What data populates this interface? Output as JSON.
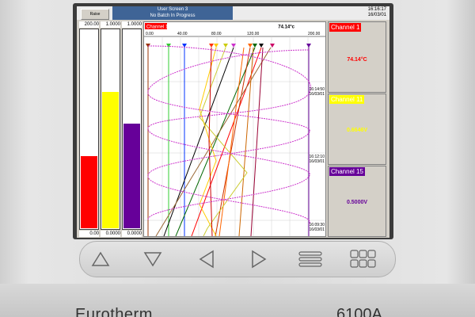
{
  "header": {
    "raise_label": "Raise",
    "screen_title": "User Screen 3",
    "batch_status": "No Batch In Progress",
    "time": "16:16:17",
    "date": "16/03/01"
  },
  "bars": [
    {
      "top": "200.00",
      "bottom": "0.00",
      "color": "#ff0000",
      "fill": 0.37
    },
    {
      "top": "1.0000",
      "bottom": "0.0000",
      "color": "#ffff00",
      "fill": 0.69
    },
    {
      "top": "1.0000",
      "bottom": "0.0000",
      "color": "#660099",
      "fill": 0.53
    }
  ],
  "chart": {
    "channel_label": "Channel 1",
    "value": "74.14°c",
    "scale_ticks": [
      "0.00",
      "40.00",
      "80.00",
      "120.00",
      "200.00"
    ],
    "timestamps": [
      {
        "time": "16:14:50",
        "date": "16/03/01"
      },
      {
        "time": "16:12:10",
        "date": "16/03/01"
      },
      {
        "time": "16:09:30",
        "date": "16/03/01"
      }
    ]
  },
  "panels": [
    {
      "label": "Channel 1",
      "value": "74.14°C",
      "color": "#ff0000",
      "value_color": "#ff0000"
    },
    {
      "label": "Channel 11",
      "value": "0.6646V",
      "color": "#ffff00",
      "value_color": "#ffff00"
    },
    {
      "label": "Channel 15",
      "value": "0.5000V",
      "color": "#660099",
      "value_color": "#660099"
    }
  ],
  "nav": [
    {
      "icon": "triangle-up-icon"
    },
    {
      "icon": "triangle-down-icon"
    },
    {
      "icon": "triangle-left-icon"
    },
    {
      "icon": "triangle-right-icon"
    },
    {
      "icon": "menu-icon"
    },
    {
      "icon": "grid-icon"
    }
  ],
  "brand": "Eurotherm",
  "model": "6100A"
}
